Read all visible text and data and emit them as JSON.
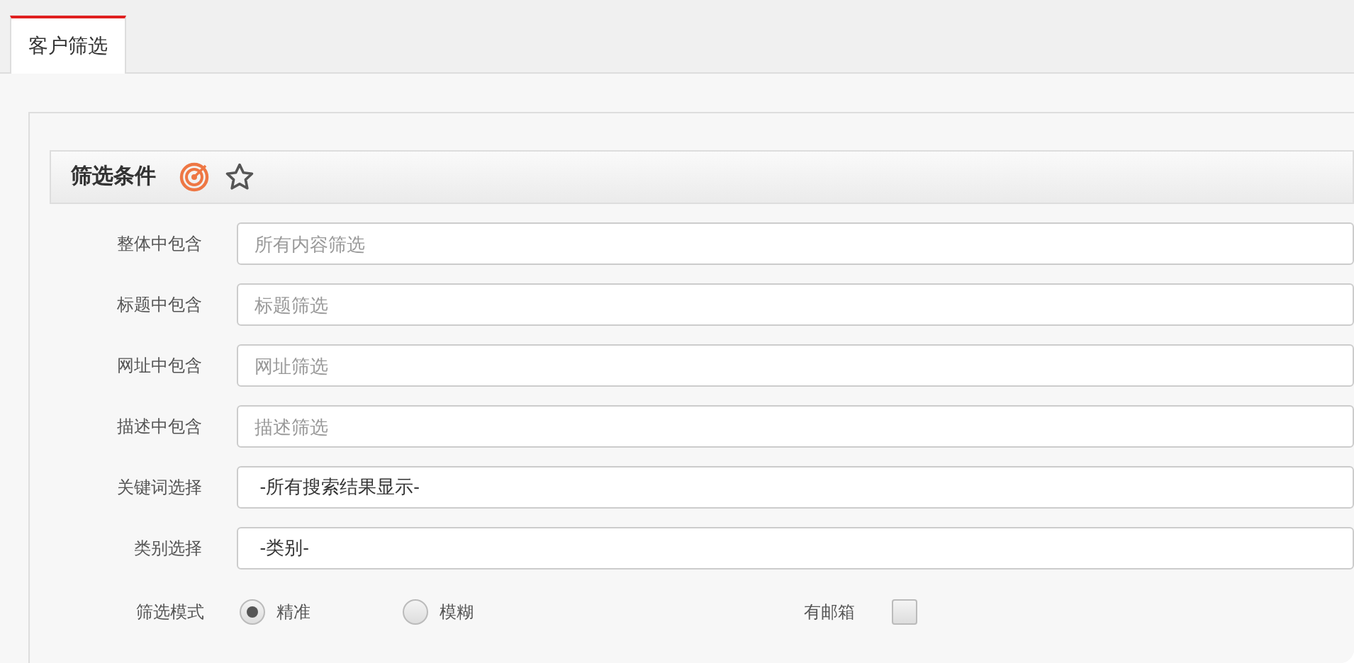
{
  "tabs": [
    {
      "label": "客户筛选",
      "selected": true
    }
  ],
  "section": {
    "title": "筛选条件"
  },
  "fields": [
    {
      "kind": "input",
      "label": "整体中包含",
      "placeholder": "所有内容筛选"
    },
    {
      "kind": "input",
      "label": "标题中包含",
      "placeholder": "标题筛选"
    },
    {
      "kind": "input",
      "label": "网址中包含",
      "placeholder": "网址筛选"
    },
    {
      "kind": "input",
      "label": "描述中包含",
      "placeholder": "描述筛选"
    },
    {
      "kind": "select",
      "label": "关键词选择",
      "value": "-所有搜索结果显示-"
    },
    {
      "kind": "select",
      "label": "类别选择",
      "value": "-类别-"
    }
  ],
  "mode": {
    "label": "筛选模式",
    "options": [
      {
        "label": "精准",
        "selected": true
      },
      {
        "label": "模糊",
        "selected": false
      }
    ]
  },
  "email": {
    "label": "有邮箱",
    "checked": false
  }
}
